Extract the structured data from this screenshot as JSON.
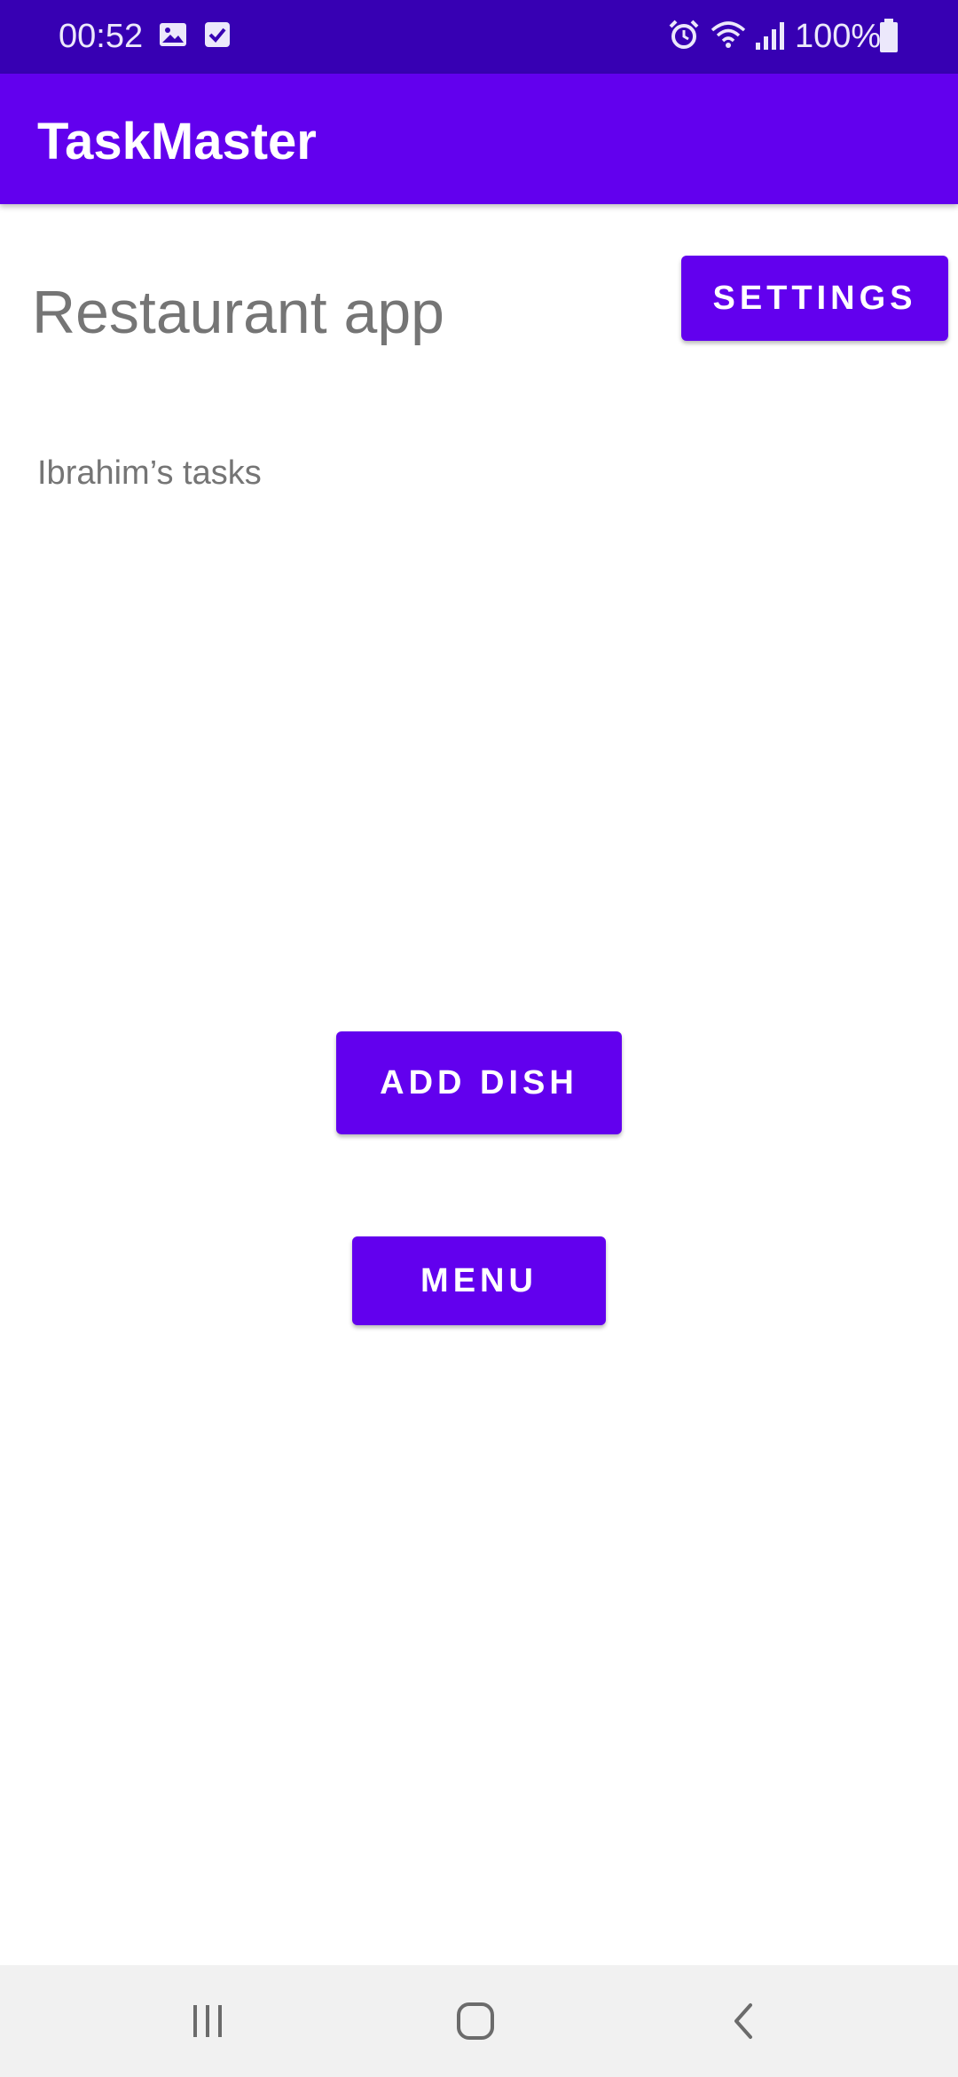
{
  "status_bar": {
    "time": "00:52",
    "battery": "100%",
    "icons": [
      "image-icon",
      "checkbox-icon",
      "alarm-icon",
      "wifi-icon",
      "signal-icon",
      "battery-icon"
    ]
  },
  "app_bar": {
    "title": "TaskMaster"
  },
  "main": {
    "heading": "Restaurant app",
    "tasks_label": "Ibrahim’s tasks",
    "settings_label": "SETTINGS",
    "add_dish_label": "ADD DISH",
    "menu_label": "MENU"
  },
  "nav_bar": {
    "icons": [
      "recent-apps-icon",
      "home-icon",
      "back-icon"
    ]
  },
  "colors": {
    "primary": "#6200ee",
    "primary_dark": "#3700b3",
    "text_secondary": "#757575"
  }
}
